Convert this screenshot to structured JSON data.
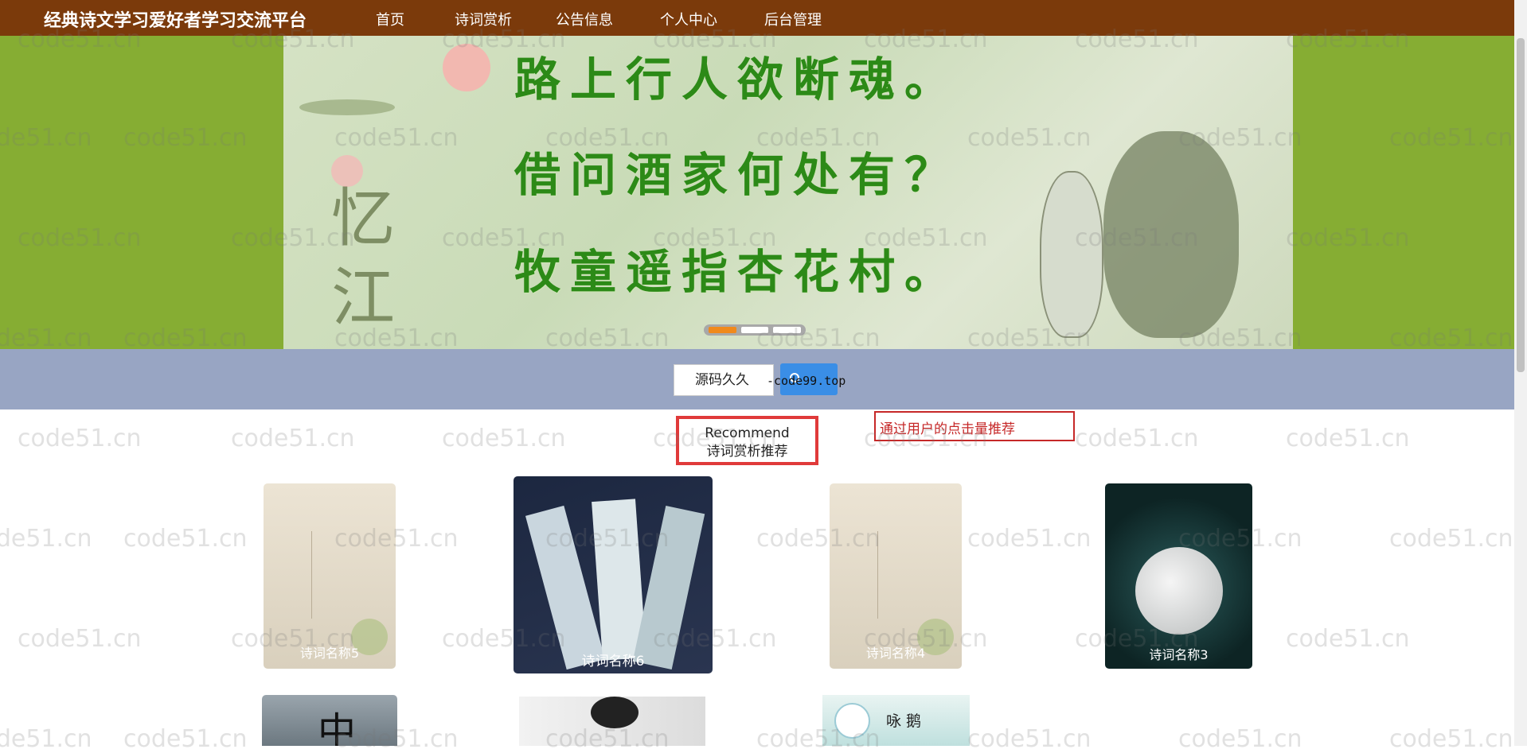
{
  "header": {
    "brand": "经典诗文学习爱好者学习交流平台",
    "nav": [
      "首页",
      "诗词赏析",
      "公告信息",
      "个人中心",
      "后台管理"
    ]
  },
  "banner": {
    "lines": [
      "路上行人欲断魂。",
      "借问酒家何处有？",
      "牧童遥指杏花村。"
    ],
    "active_dot": 1
  },
  "search": {
    "placeholder": "源码久久",
    "overlay_text": "-code99.top"
  },
  "recommend": {
    "title_en": "Recommend",
    "title_cn": "诗词赏析推荐",
    "note": "通过用户的点击量推荐"
  },
  "cards_row1": [
    {
      "title": "诗词名称5"
    },
    {
      "title": "诗词名称6"
    },
    {
      "title": "诗词名称4"
    },
    {
      "title": "诗词名称3"
    }
  ],
  "cards_row2_text": [
    "中",
    "咏 鹅"
  ],
  "watermark": "code51.cn",
  "colors": {
    "header_bg": "#7b3a0b",
    "banner_bg": "#86ad33",
    "search_bg": "#98a5c3",
    "highlight_red": "#e03a3a"
  }
}
